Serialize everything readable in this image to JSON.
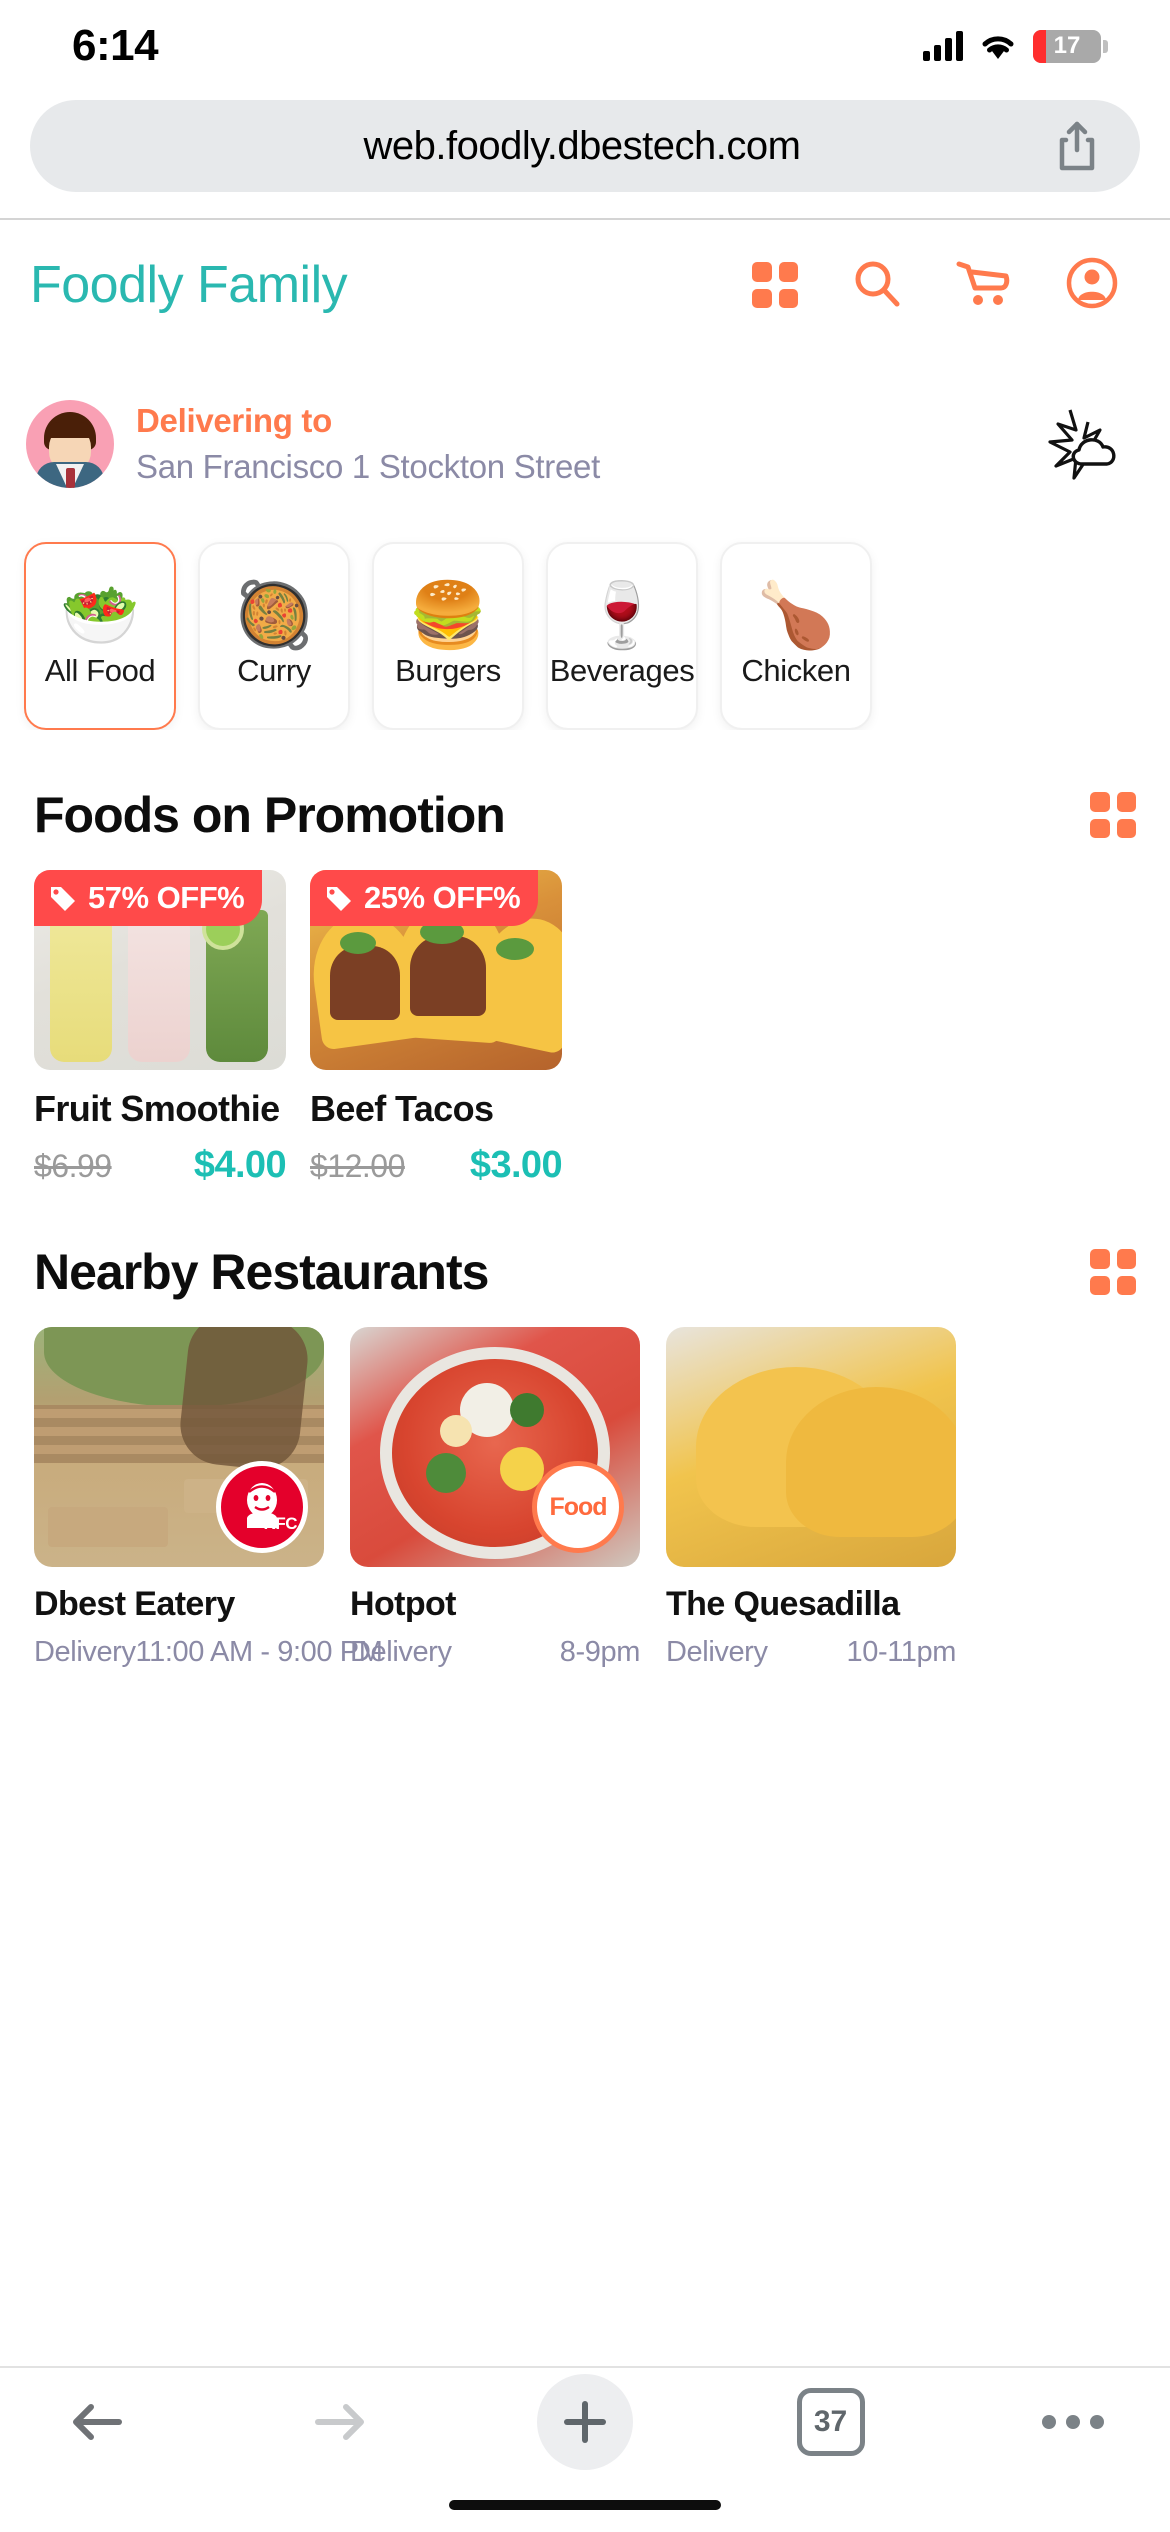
{
  "status_bar": {
    "time": "6:14",
    "battery_level": "17",
    "signal_icon": "cellular-signal-icon",
    "wifi_icon": "wifi-icon"
  },
  "browser": {
    "url": "web.foodly.dbestech.com",
    "share_icon": "share-icon"
  },
  "app_header": {
    "brand": "Foodly Family",
    "icons": [
      {
        "name": "grid-menu-icon",
        "label": "Grid"
      },
      {
        "name": "search-icon",
        "label": "Search"
      },
      {
        "name": "cart-icon",
        "label": "Cart"
      },
      {
        "name": "profile-icon",
        "label": "Profile"
      }
    ],
    "brand_color": "#2ab8b0",
    "accent_color": "#ff7a4d"
  },
  "delivery": {
    "label": "Delivering to",
    "address": "San Francisco 1 Stockton Street",
    "avatar_icon": "user-avatar",
    "weather_icon": "sun-cloud-icon"
  },
  "categories": [
    {
      "label": "All Food",
      "emoji": "🥗",
      "selected": true
    },
    {
      "label": "Curry",
      "emoji": "🥘",
      "selected": false
    },
    {
      "label": "Burgers",
      "emoji": "🍔",
      "selected": false
    },
    {
      "label": "Beverages",
      "emoji": "🍷",
      "selected": false
    },
    {
      "label": "Chicken",
      "emoji": "🍗",
      "selected": false
    }
  ],
  "promotions": {
    "title": "Foods on Promotion",
    "view_all_icon": "grid-view-icon",
    "items": [
      {
        "name": "Fruit Smoothie",
        "badge": "57% OFF%",
        "price_old": "$6.99",
        "price_new": "$4.00",
        "image": "fruit-smoothie-photo"
      },
      {
        "name": "Beef Tacos",
        "badge": "25% OFF%",
        "price_old": "$12.00",
        "price_new": "$3.00",
        "image": "beef-tacos-photo"
      }
    ]
  },
  "restaurants": {
    "title": "Nearby Restaurants",
    "view_all_icon": "grid-view-icon",
    "items": [
      {
        "name": "Dbest Eatery",
        "delivery": "Delivery",
        "hours": "11:00 AM - 9:00 PM",
        "logo": "kfc-logo",
        "logo_text": "KFC",
        "image": "patio-photo"
      },
      {
        "name": "Hotpot",
        "delivery": "Delivery",
        "hours": "8-9pm",
        "logo": "food-logo",
        "logo_text": "Food",
        "image": "hotpot-photo"
      },
      {
        "name": "The Quesadilla",
        "delivery": "Delivery",
        "hours": "10-11pm",
        "logo": "",
        "logo_text": "",
        "image": "quesadilla-photo"
      }
    ]
  },
  "toolbar": {
    "back_icon": "back-arrow-icon",
    "forward_icon": "forward-arrow-icon",
    "new_tab_icon": "plus-icon",
    "tab_count": "37",
    "more_icon": "more-options-icon"
  },
  "colors": {
    "teal": "#2ab8b0",
    "orange": "#ff7a4d",
    "badge_red": "#ff4a4a",
    "price_teal": "#1cbfb4",
    "muted": "#8b8aa6"
  }
}
